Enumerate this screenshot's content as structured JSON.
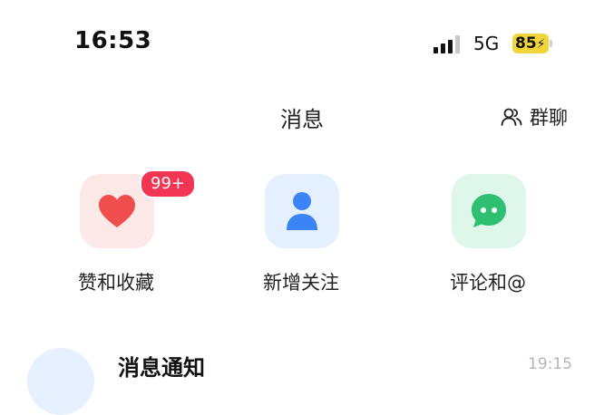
{
  "status_bar": {
    "time": "16:53",
    "network": "5G",
    "battery": "85",
    "battery_color": "#f2d53a"
  },
  "header": {
    "title": "消息",
    "group_chat_label": "群聊",
    "group_chat_icon": "people-icon"
  },
  "shortcuts": [
    {
      "label": "赞和收藏",
      "icon": "heart-icon",
      "badge": "99+",
      "bg": "#fde8e8",
      "icon_color": "#f04e4e"
    },
    {
      "label": "新增关注",
      "icon": "user-icon",
      "bg": "#e4efff",
      "icon_color": "#3a84f5"
    },
    {
      "label": "评论和@",
      "icon": "chat-bubble-icon",
      "bg": "#dff7ea",
      "icon_color": "#2fbf71"
    }
  ],
  "list": {
    "first_item_title": "消息通知",
    "first_item_time": "19:15"
  }
}
